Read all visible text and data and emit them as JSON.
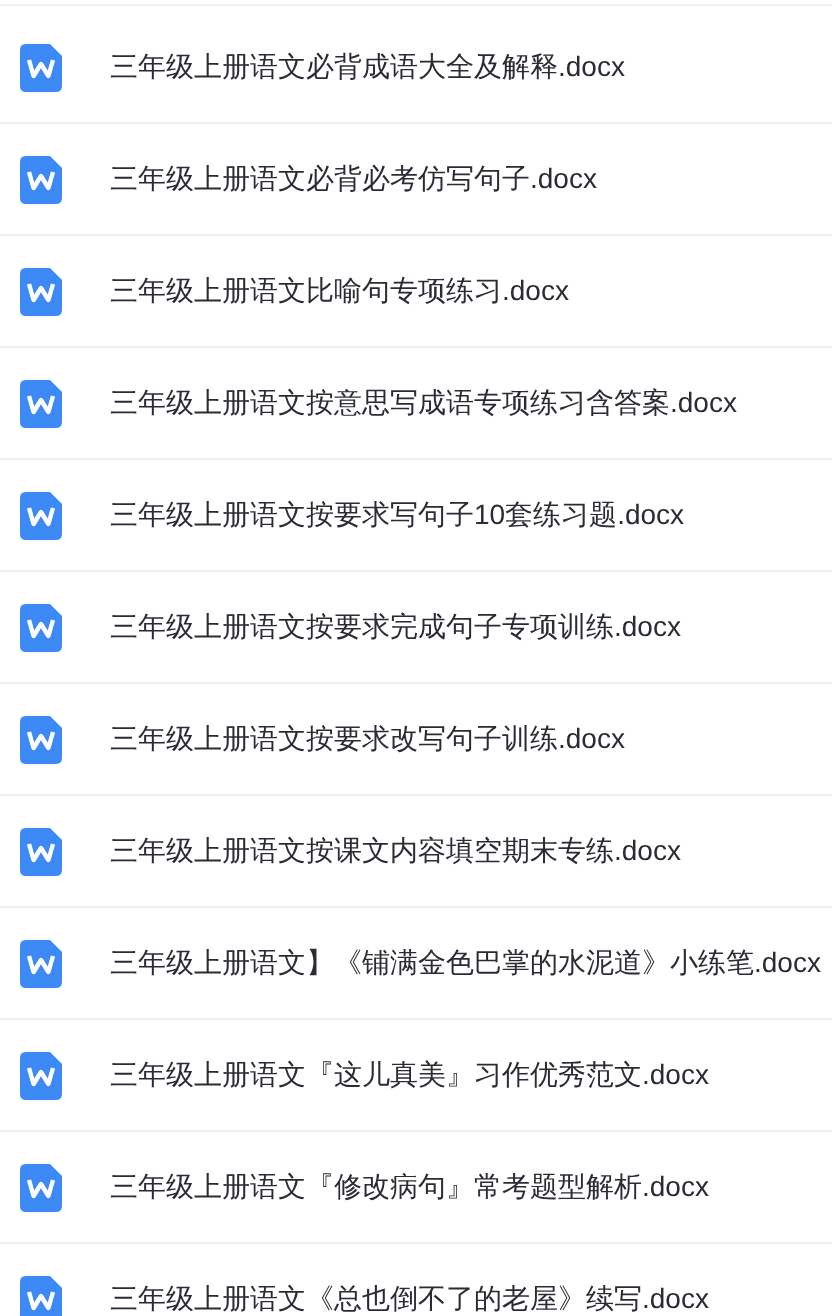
{
  "files": [
    {
      "name": "三年级上册语文必背成语大全及解释.docx"
    },
    {
      "name": "三年级上册语文必背必考仿写句子.docx"
    },
    {
      "name": "三年级上册语文比喻句专项练习.docx"
    },
    {
      "name": "三年级上册语文按意思写成语专项练习含答案.docx"
    },
    {
      "name": "三年级上册语文按要求写句子10套练习题.docx"
    },
    {
      "name": "三年级上册语文按要求完成句子专项训练.docx"
    },
    {
      "name": "三年级上册语文按要求改写句子训练.docx"
    },
    {
      "name": "三年级上册语文按课文内容填空期末专练.docx"
    },
    {
      "name": "三年级上册语文】《铺满金色巴掌的水泥道》小练笔.docx"
    },
    {
      "name": "三年级上册语文『这儿真美』习作优秀范文.docx"
    },
    {
      "name": "三年级上册语文『修改病句』常考题型解析.docx"
    },
    {
      "name": "三年级上册语文《总也倒不了的老屋》续写.docx"
    }
  ]
}
